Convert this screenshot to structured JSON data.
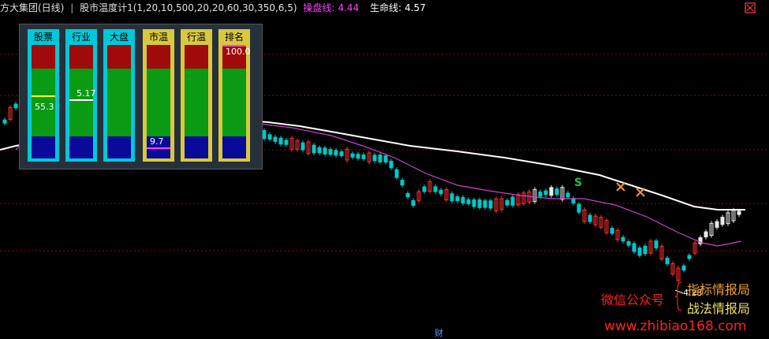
{
  "header": {
    "title": "方大集团(日线)",
    "indicator": "股市温度计1(1,20,10,500,20,20,60,30,350,6,5)",
    "cp_label": "操盘线:",
    "cp_value": "4.44",
    "life_label": "生命线:",
    "life_value": "4.57"
  },
  "panel": {
    "columns": [
      {
        "label": "股票",
        "value": "55.3",
        "level": 0.553,
        "label_bg": "#00c8d8",
        "frame": "#00c8d8",
        "marker_color": "#ffff00"
      },
      {
        "label": "行业",
        "value": "5.17",
        "level": 0.52,
        "label_bg": "#00c8d8",
        "frame": "#00c8d8",
        "marker_color": "#ffffff"
      },
      {
        "label": "大盘",
        "value": "",
        "level": null,
        "label_bg": "#00c8d8",
        "frame": "#00c8d8",
        "marker_color": ""
      },
      {
        "label": "市温",
        "value": "9.7",
        "level": 0.097,
        "label_bg": "#d8c840",
        "frame": "#d8c840",
        "marker_color": "#ff40ff"
      },
      {
        "label": "行温",
        "value": "",
        "level": null,
        "label_bg": "#d8c840",
        "frame": "#d8c840",
        "marker_color": ""
      },
      {
        "label": "排名",
        "value": "100.0",
        "level": 1.0,
        "label_bg": "#d8c840",
        "frame": "#d8c840",
        "marker_color": "#ff40ff"
      }
    ]
  },
  "annotations": {
    "signal_s": "S",
    "low_price": "4.23",
    "cai_label": "财"
  },
  "watermark": {
    "gzh": "微信公众号",
    "line1": "指标情报局",
    "line2": "战法情报局",
    "url": "www.zhibiao168.com"
  },
  "colors": {
    "background": "#000000",
    "grid": "#7a1010",
    "up_candle": "#ff3030",
    "down_candle": "#00c8c8",
    "white_candle": "#e8e8e8",
    "life_line": "#ffffff",
    "cp_line": "#d040d0"
  },
  "icons": [
    "settings-icon"
  ]
}
